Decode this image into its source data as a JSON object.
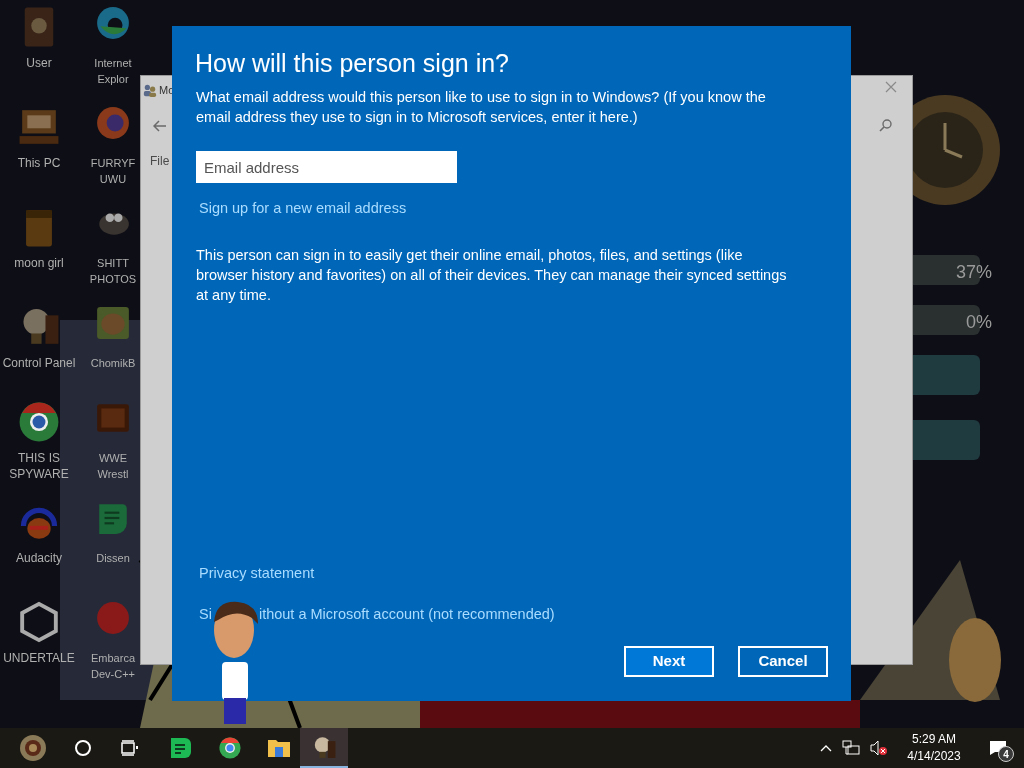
{
  "desktop_icons": [
    {
      "kind": "user",
      "label_lines": [
        "User"
      ]
    },
    {
      "kind": "edge",
      "label_lines": [
        "Internet",
        "Explor"
      ]
    },
    {
      "kind": "computer",
      "label_lines": [
        "This PC"
      ]
    },
    {
      "kind": "firefox",
      "label_lines": [
        "FURRYF",
        "UWU"
      ]
    },
    {
      "kind": "bag",
      "label_lines": [
        "moon girl"
      ]
    },
    {
      "kind": "gimp",
      "label_lines": [
        "SHITT",
        "PHOTOS"
      ]
    },
    {
      "kind": "bulb",
      "label_lines": [
        "Control Panel"
      ]
    },
    {
      "kind": "animal",
      "label_lines": [
        "ChomikB"
      ]
    },
    {
      "kind": "chrome",
      "label_lines": [
        "THIS IS",
        "SPYWARE"
      ]
    },
    {
      "kind": "tv",
      "label_lines": [
        "WWE",
        "Wrestl"
      ]
    },
    {
      "kind": "audacity",
      "label_lines": [
        "Audacity"
      ]
    },
    {
      "kind": "chat",
      "label_lines": [
        "Dissen"
      ]
    },
    {
      "kind": "unity",
      "label_lines": [
        "UNDERTALE"
      ]
    },
    {
      "kind": "devcpp",
      "label_lines": [
        "Embarca",
        "Dev-C++"
      ]
    }
  ],
  "background_window": {
    "title": "Mo",
    "menu": "File"
  },
  "widgets": [
    {
      "reading": "37%"
    },
    {
      "reading": "0%"
    }
  ],
  "dialog": {
    "title": "How will this person sign in?",
    "prompt": "What email address would this person like to use to sign in to Windows? (If you know the email address they use to sign in to Microsoft services, enter it here.)",
    "email_field": {
      "placeholder": "Email address"
    },
    "signup_link": "Sign up for a new email address",
    "info": "This person can sign in to easily get their online email, photos, files, and settings (like browser history and favorites) on all of their devices. They can manage their synced settings at any time.",
    "privacy_link": "Privacy statement",
    "local_account_link_parts": [
      "Si",
      "ithout a Microsoft account (not recommended)"
    ],
    "buttons": [
      {
        "label": "Next",
        "kind": "primary"
      },
      {
        "label": "Cancel",
        "kind": "secondary"
      }
    ]
  },
  "taskbar": {
    "apps": [
      {
        "kind": "start",
        "selected": false
      },
      {
        "kind": "search",
        "selected": false
      },
      {
        "kind": "taskview",
        "selected": false
      },
      {
        "kind": "chat",
        "selected": false
      },
      {
        "kind": "chrome",
        "selected": false
      },
      {
        "kind": "folder",
        "selected": false
      },
      {
        "kind": "bulb",
        "selected": true
      }
    ],
    "clock": {
      "time": "5:29 AM",
      "date": "4/14/2023"
    },
    "notifications": {
      "count": "4"
    }
  }
}
